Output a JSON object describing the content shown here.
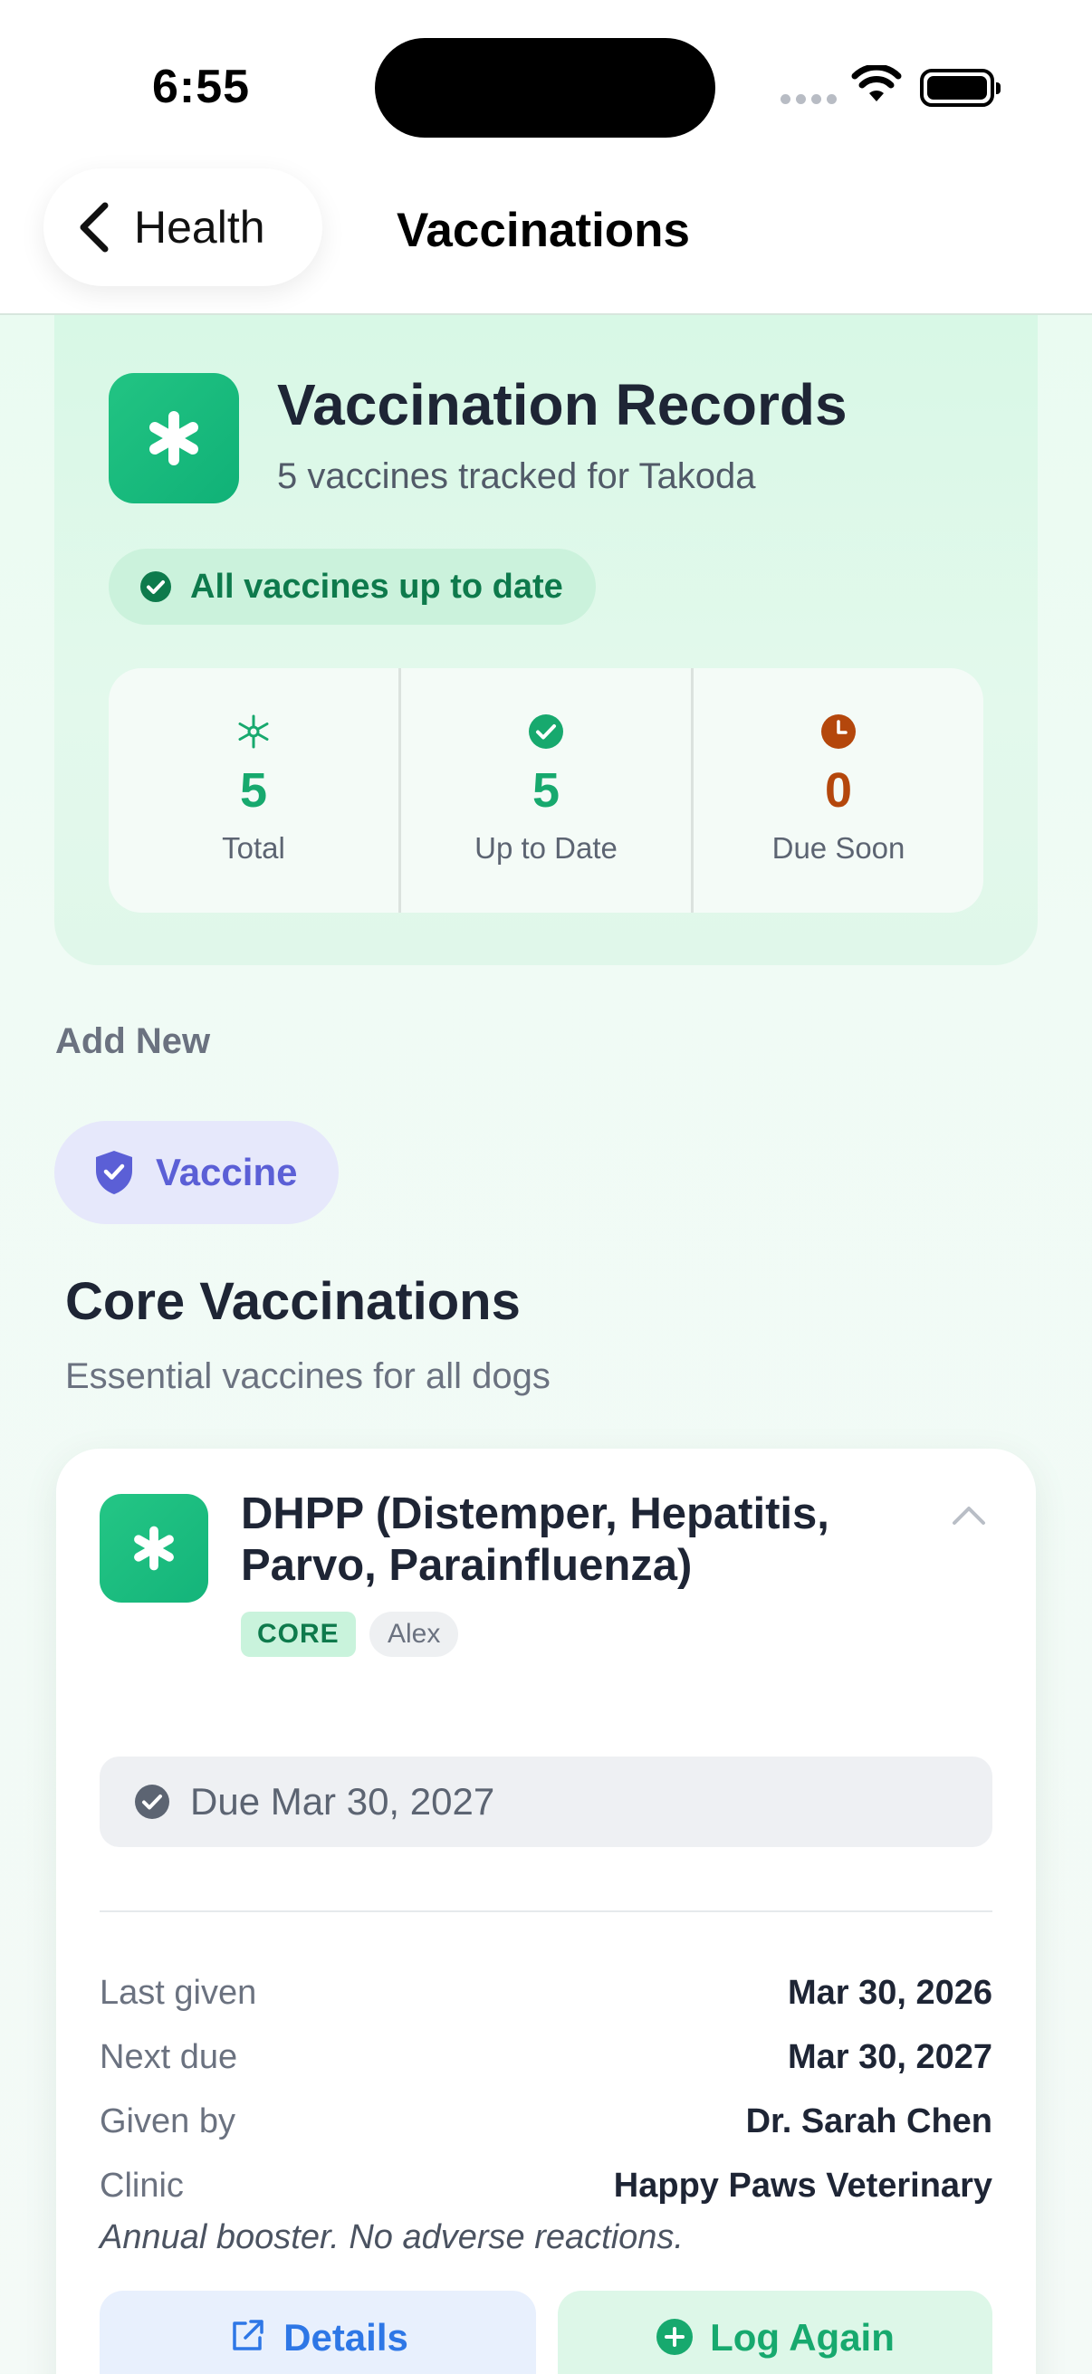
{
  "status_bar": {
    "time": "6:55"
  },
  "nav": {
    "back_label": "Health",
    "title": "Vaccinations"
  },
  "summary": {
    "title": "Vaccination Records",
    "subtitle": "5 vaccines tracked for Takoda",
    "status": "All vaccines up to date",
    "stats": [
      {
        "value": "5",
        "label": "Total",
        "icon": "asterisk-icon",
        "color": "#17a96e"
      },
      {
        "value": "5",
        "label": "Up to Date",
        "icon": "check-circle-icon",
        "color": "#17a96e"
      },
      {
        "value": "0",
        "label": "Due Soon",
        "icon": "clock-icon",
        "color": "#b4470c"
      }
    ]
  },
  "add_new": {
    "label": "Add New",
    "vaccine_button": "Vaccine"
  },
  "section": {
    "title": "Core Vaccinations",
    "subtitle": "Essential vaccines for all dogs"
  },
  "vaccine_card": {
    "name": "DHPP (Distemper, Hepatitis, Parvo, Parainfluenza)",
    "badge": "CORE",
    "user": "Alex",
    "due": "Due Mar 30, 2027",
    "details": [
      {
        "key": "Last given",
        "value": "Mar 30, 2026"
      },
      {
        "key": "Next due",
        "value": "Mar 30, 2027"
      },
      {
        "key": "Given by",
        "value": "Dr. Sarah Chen"
      },
      {
        "key": "Clinic",
        "value": "Happy Paws Veterinary"
      }
    ],
    "note": "Annual booster. No adverse reactions.",
    "details_button": "Details",
    "log_button": "Log Again"
  },
  "colors": {
    "accent_green": "#17a96e",
    "accent_orange": "#b4470c",
    "accent_indigo": "#5b5fd6",
    "accent_blue": "#2e77e6"
  }
}
